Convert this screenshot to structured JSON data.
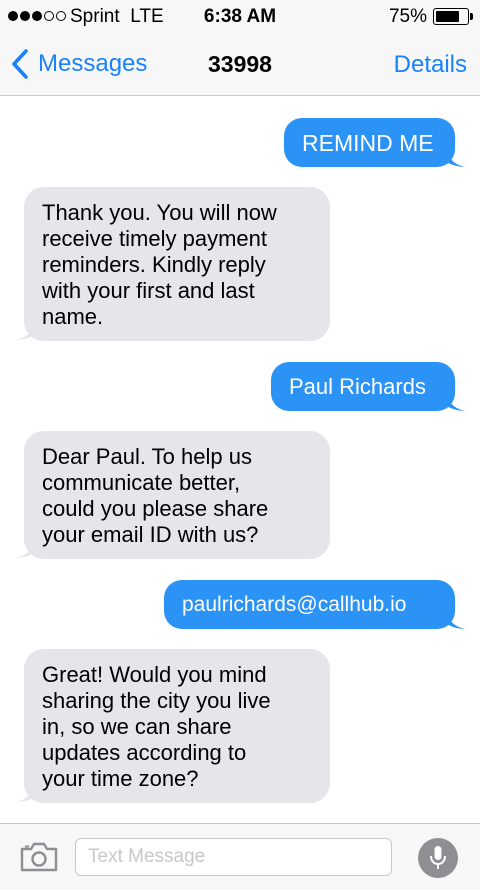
{
  "status_bar": {
    "carrier": "Sprint",
    "network": "LTE",
    "time": "6:38 AM",
    "battery_percent": "75%",
    "battery_level": 0.75,
    "signal_bars_filled": 3,
    "signal_bars_total": 5
  },
  "nav": {
    "back_label": "Messages",
    "title": "33998",
    "details_label": "Details"
  },
  "messages": [
    {
      "direction": "outgoing",
      "text": "REMIND ME"
    },
    {
      "direction": "incoming",
      "lines": [
        "Thank you. You will now",
        "receive timely payment",
        "reminders. Kindly reply",
        "with your first and last",
        "name."
      ]
    },
    {
      "direction": "outgoing",
      "text": "Paul Richards"
    },
    {
      "direction": "incoming",
      "lines": [
        "Dear Paul. To help us",
        "communicate better,",
        "could you please share",
        "your email ID with us?"
      ]
    },
    {
      "direction": "outgoing",
      "text": "paulrichards@callhub.io"
    },
    {
      "direction": "incoming",
      "lines": [
        "Great! Would you mind",
        "sharing the city you live",
        "in, so we can share",
        "updates according to",
        "your time zone?"
      ]
    }
  ],
  "input": {
    "placeholder": "Text Message"
  },
  "colors": {
    "accent": "#1a82fb",
    "outgoing_bubble": "#2b93f5",
    "incoming_bubble": "#e5e5ea"
  },
  "icons": {
    "back": "chevron-left-icon",
    "camera": "camera-icon",
    "mic": "microphone-icon"
  }
}
